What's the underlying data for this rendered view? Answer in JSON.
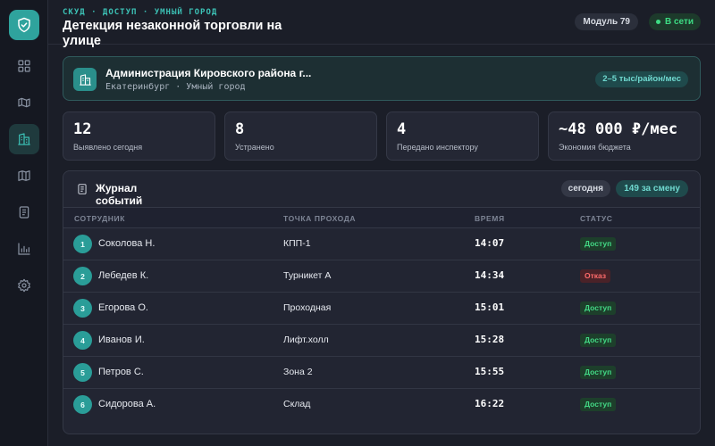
{
  "sidebar": {
    "logo_icon": "shield-check-icon",
    "items": [
      {
        "icon": "dashboard-icon",
        "active": false
      },
      {
        "icon": "map-route-icon",
        "active": false
      },
      {
        "icon": "building-icon",
        "active": true
      },
      {
        "icon": "map-icon",
        "active": false
      },
      {
        "icon": "document-icon",
        "active": false
      },
      {
        "icon": "chart-icon",
        "active": false
      },
      {
        "icon": "gear-icon",
        "active": false
      }
    ]
  },
  "header": {
    "breadcrumb": "СКУД · ДОСТУП · УМНЫЙ ГОРОД",
    "title": "Детекция незаконной торговли на улице",
    "module": "Модуль 79",
    "status": "В сети"
  },
  "org": {
    "icon": "building-icon",
    "name": "Администрация Кировского района г...",
    "subtitle": "Екатеринбург · Умный город",
    "pricing": "2–5 тыс/район/мес"
  },
  "stats": [
    {
      "value": "12",
      "label": "Выявлено сегодня"
    },
    {
      "value": "8",
      "label": "Устранено"
    },
    {
      "value": "4",
      "label": "Передано инспектору"
    },
    {
      "value": "~48 000 ₽/мес",
      "label": "Экономия бюджета"
    }
  ],
  "log": {
    "icon": "document-icon",
    "title": "Журнал событий",
    "filter_today": "сегодня",
    "shift_count": "149 за смену",
    "columns": [
      "СОТРУДНИК",
      "ТОЧКА ПРОХОДА",
      "ВРЕМЯ",
      "СТАТУС"
    ],
    "rows": [
      {
        "num": "1",
        "name": "Соколова Н.",
        "point": "КПП-1",
        "time": "14:07",
        "status": "Доступ",
        "status_type": "ok"
      },
      {
        "num": "2",
        "name": "Лебедев К.",
        "point": "Турникет А",
        "time": "14:34",
        "status": "Отказ",
        "status_type": "deny"
      },
      {
        "num": "3",
        "name": "Егорова О.",
        "point": "Проходная",
        "time": "15:01",
        "status": "Доступ",
        "status_type": "ok"
      },
      {
        "num": "4",
        "name": "Иванов И.",
        "point": "Лифт.холл",
        "time": "15:28",
        "status": "Доступ",
        "status_type": "ok"
      },
      {
        "num": "5",
        "name": "Петров С.",
        "point": "Зона 2",
        "time": "15:55",
        "status": "Доступ",
        "status_type": "ok"
      },
      {
        "num": "6",
        "name": "Сидорова А.",
        "point": "Склад",
        "time": "16:22",
        "status": "Доступ",
        "status_type": "ok"
      }
    ]
  },
  "colors": {
    "accent": "#2fa39d",
    "success": "#3ddc84",
    "danger": "#ff6b6b",
    "background": "#1b1e28"
  }
}
